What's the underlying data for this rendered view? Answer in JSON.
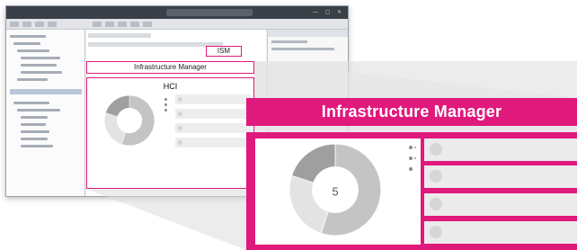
{
  "screenshot": {
    "ism_label": "ISM",
    "infra_label": "Infrastructure Manager",
    "hci_label": "HCI"
  },
  "callout": {
    "title": "Infrastructure Manager",
    "donut_caption": "5",
    "rows": [
      "",
      "",
      "",
      ""
    ]
  },
  "donut": {
    "segments": [
      {
        "fraction": 0.55,
        "color": "#c4c4c4"
      },
      {
        "fraction": 0.25,
        "color": "#e3e3e3"
      },
      {
        "fraction": 0.2,
        "color": "#9f9f9f"
      }
    ]
  },
  "colors": {
    "accent": "#e0197d"
  }
}
